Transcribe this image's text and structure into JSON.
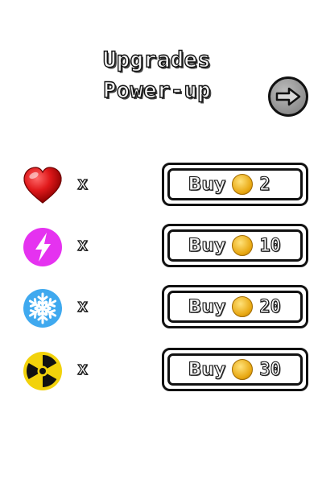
{
  "header": {
    "title_line1": "Upgrades",
    "title_line2": "Power-up",
    "next_icon": "arrow-right-icon"
  },
  "powerups": [
    {
      "icon": "heart-icon",
      "color": "#e0191b",
      "x_label": "x",
      "buy_label": "Buy",
      "currency_icon": "coin-icon",
      "price": "2"
    },
    {
      "icon": "lightning-icon",
      "color": "#e532f0",
      "x_label": "x",
      "buy_label": "Buy",
      "currency_icon": "coin-icon",
      "price": "10"
    },
    {
      "icon": "snowflake-icon",
      "color": "#3fa9ef",
      "x_label": "x",
      "buy_label": "Buy",
      "currency_icon": "coin-icon",
      "price": "20"
    },
    {
      "icon": "radiation-icon",
      "color": "#f2d20b",
      "x_label": "x",
      "buy_label": "Buy",
      "currency_icon": "coin-icon",
      "price": "30"
    }
  ]
}
